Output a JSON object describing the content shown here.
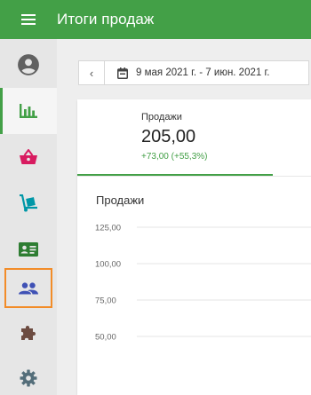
{
  "header": {
    "title": "Итоги продаж",
    "menu_icon": "hamburger-icon"
  },
  "sidebar": {
    "items": [
      {
        "name": "account",
        "icon": "account-circle-icon",
        "color": "#616161"
      },
      {
        "name": "analytics",
        "icon": "bar-chart-icon",
        "color": "#43a047",
        "active": true
      },
      {
        "name": "orders",
        "icon": "basket-icon",
        "color": "#d81b60"
      },
      {
        "name": "shipping",
        "icon": "hand-truck-icon",
        "color": "#0097a7"
      },
      {
        "name": "customers-card",
        "icon": "id-card-icon",
        "color": "#2e7d32"
      },
      {
        "name": "customers",
        "icon": "people-icon",
        "color": "#3f51b5",
        "focused": true
      },
      {
        "name": "plugins",
        "icon": "puzzle-icon",
        "color": "#6d4c41"
      },
      {
        "name": "settings",
        "icon": "gear-icon",
        "color": "#546e7a"
      }
    ]
  },
  "date_range": {
    "prev_label": "‹",
    "label": "9 мая 2021 г. - 7 июн. 2021 г."
  },
  "summary": {
    "label": "Продажи",
    "value": "205,00",
    "delta": "+73,00 (+55,3%)"
  },
  "chart_data": {
    "type": "line",
    "title": "Продажи",
    "y_ticks": [
      "125,00",
      "100,00",
      "75,00",
      "50,00"
    ],
    "ylim": [
      50,
      125
    ],
    "grid": true
  },
  "colors": {
    "accent": "#43a047",
    "focus_outline": "#f28c28"
  }
}
